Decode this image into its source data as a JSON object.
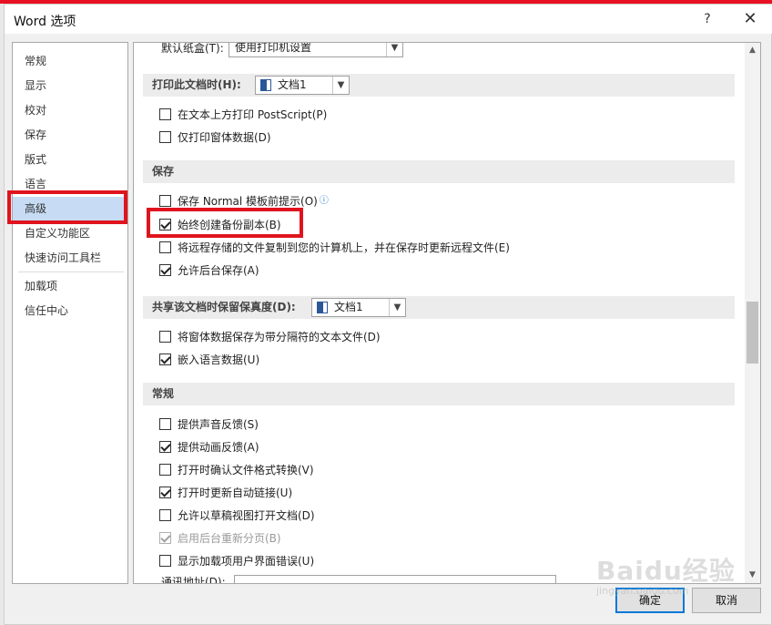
{
  "window": {
    "title": "Word 选项",
    "help_glyph": "?",
    "close_glyph": "✕"
  },
  "nav": {
    "items": [
      "常规",
      "显示",
      "校对",
      "保存",
      "版式",
      "语言",
      "高级",
      "自定义功能区",
      "快速访问工具栏",
      "加载项",
      "信任中心"
    ],
    "selected": "高级"
  },
  "content": {
    "top_partial": {
      "label": "默认纸盒(T):",
      "value": "使用打印机设置"
    },
    "print_doc": {
      "label": "打印此文档时(H):",
      "value": "文档1"
    },
    "print_items": [
      {
        "label": "在文本上方打印 PostScript(P)",
        "checked": false
      },
      {
        "label": "仅打印窗体数据(D)",
        "checked": false
      }
    ],
    "save_section": {
      "title": "保存"
    },
    "save_items": [
      {
        "label": "保存 Normal 模板前提示(O)",
        "checked": false,
        "info": "ⓘ"
      },
      {
        "label": "始终创建备份副本(B)",
        "checked": true
      },
      {
        "label": "将远程存储的文件复制到您的计算机上，并在保存时更新远程文件(E)",
        "checked": false
      },
      {
        "label": "允许后台保存(A)",
        "checked": true
      }
    ],
    "share_doc": {
      "label": "共享该文档时保留保真度(D):",
      "value": "文档1"
    },
    "share_items": [
      {
        "label": "将窗体数据保存为带分隔符的文本文件(D)",
        "checked": false
      },
      {
        "label": "嵌入语言数据(U)",
        "checked": true
      }
    ],
    "general_section": {
      "title": "常规"
    },
    "general_items": [
      {
        "label": "提供声音反馈(S)",
        "checked": false
      },
      {
        "label": "提供动画反馈(A)",
        "checked": true
      },
      {
        "label": "打开时确认文件格式转换(V)",
        "checked": false
      },
      {
        "label": "打开时更新自动链接(U)",
        "checked": true
      },
      {
        "label": "允许以草稿视图打开文档(D)",
        "checked": false
      },
      {
        "label": "启用后台重新分页(B)",
        "checked": true,
        "disabled": true
      },
      {
        "label": "显示加载项用户界面错误(U)",
        "checked": false
      }
    ],
    "mailing_address": {
      "label": "通讯地址(D):",
      "value": ""
    }
  },
  "footer": {
    "ok": "确定",
    "cancel": "取消"
  },
  "watermark": {
    "text": "Baidu经验",
    "sub": "jingyan.baidu.com"
  },
  "colors": {
    "highlight_box": "#e0141e",
    "nav_selected": "#c7dcf4",
    "default_button_border": "#0078d7"
  }
}
